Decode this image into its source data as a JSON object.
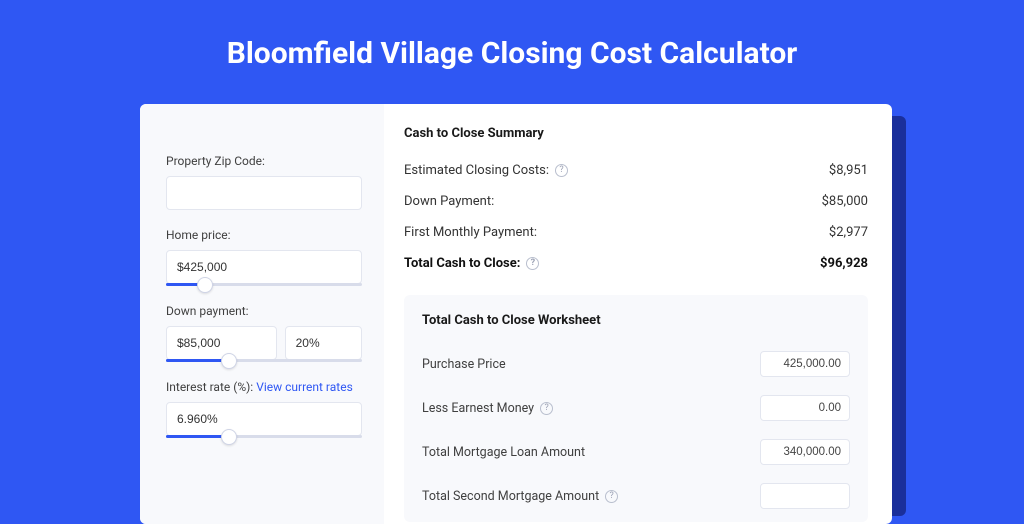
{
  "page": {
    "title": "Bloomfield Village Closing Cost Calculator"
  },
  "form": {
    "zip_label": "Property Zip Code:",
    "zip_value": "",
    "home_price_label": "Home price:",
    "home_price_value": "$425,000",
    "home_price_slider_pct": 20,
    "down_payment_label": "Down payment:",
    "down_payment_value": "$85,000",
    "down_payment_pct_value": "20%",
    "down_payment_slider_pct": 32,
    "interest_label": "Interest rate (%):",
    "interest_link": "View current rates",
    "interest_value": "6.960%",
    "interest_slider_pct": 32
  },
  "summary": {
    "title": "Cash to Close Summary",
    "rows": [
      {
        "label": "Estimated Closing Costs:",
        "help": true,
        "value": "$8,951",
        "bold": false
      },
      {
        "label": "Down Payment:",
        "help": false,
        "value": "$85,000",
        "bold": false
      },
      {
        "label": "First Monthly Payment:",
        "help": false,
        "value": "$2,977",
        "bold": false
      },
      {
        "label": "Total Cash to Close:",
        "help": true,
        "value": "$96,928",
        "bold": true
      }
    ]
  },
  "worksheet": {
    "title": "Total Cash to Close Worksheet",
    "rows": [
      {
        "label": "Purchase Price",
        "help": false,
        "value": "425,000.00"
      },
      {
        "label": "Less Earnest Money",
        "help": true,
        "value": "0.00"
      },
      {
        "label": "Total Mortgage Loan Amount",
        "help": false,
        "value": "340,000.00"
      },
      {
        "label": "Total Second Mortgage Amount",
        "help": true,
        "value": ""
      }
    ]
  }
}
